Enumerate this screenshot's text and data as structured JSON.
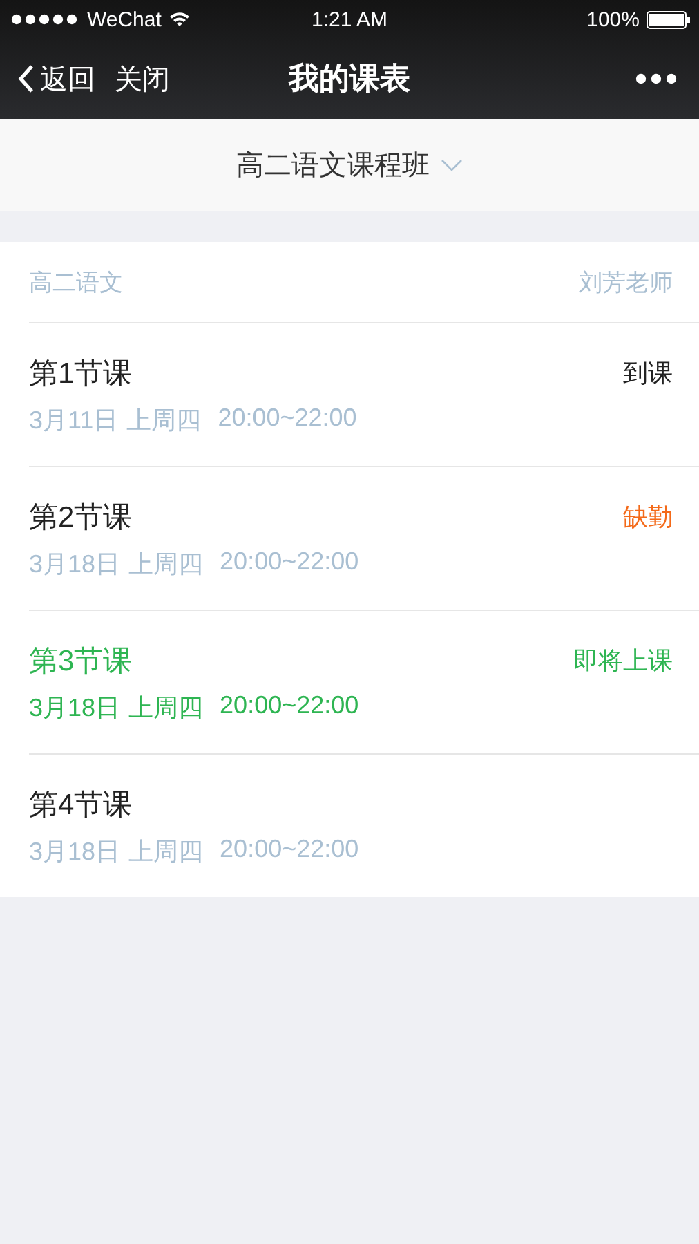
{
  "status_bar": {
    "carrier": "WeChat",
    "time": "1:21 AM",
    "battery": "100%"
  },
  "nav": {
    "back": "返回",
    "close": "关闭",
    "title": "我的课表"
  },
  "class_selector": {
    "label": "高二语文课程班"
  },
  "course": {
    "subject": "高二语文",
    "teacher": "刘芳老师"
  },
  "lessons": [
    {
      "title": "第1节课",
      "date": "3月11日",
      "weekday": "上周四",
      "time": "20:00~22:00",
      "status": "到课",
      "kind": "attended"
    },
    {
      "title": "第2节课",
      "date": "3月18日",
      "weekday": "上周四",
      "time": "20:00~22:00",
      "status": "缺勤",
      "kind": "absent"
    },
    {
      "title": "第3节课",
      "date": "3月18日",
      "weekday": "上周四",
      "time": "20:00~22:00",
      "status": "即将上课",
      "kind": "upcoming"
    },
    {
      "title": "第4节课",
      "date": "3月18日",
      "weekday": "上周四",
      "time": "20:00~22:00",
      "kind": "pending"
    }
  ]
}
